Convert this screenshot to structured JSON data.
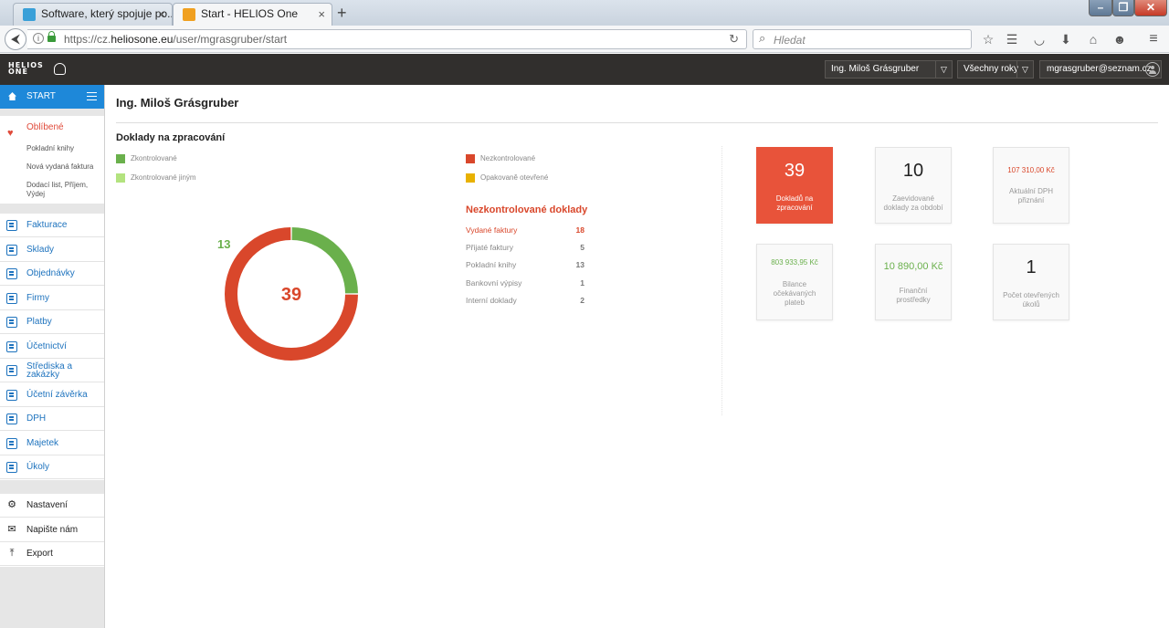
{
  "browser": {
    "tabs": [
      {
        "title": "Software, který spojuje po...",
        "close": "×"
      },
      {
        "title": "Start - HELIOS One",
        "close": "×"
      }
    ],
    "new_tab": "+",
    "url_prefix": "https://cz.",
    "url_domain": "heliosone.eu",
    "url_path": "/user/mgrasgruber/start",
    "search_placeholder": "Hledat"
  },
  "header": {
    "logo_line1": "HELIOS",
    "logo_line2": "ONE",
    "company_select": "Ing. Miloš Grásgruber",
    "year_select": "Všechny roky",
    "user_email": "mgrasgruber@seznam.cz"
  },
  "sidebar": {
    "start_label": "START",
    "favorites_label": "Oblíbené",
    "favorites": [
      "Pokladní knihy",
      "Nová vydaná faktura",
      "Dodací list, Příjem, Výdej"
    ],
    "modules": [
      "Fakturace",
      "Sklady",
      "Objednávky",
      "Firmy",
      "Platby",
      "Účetnictví",
      "Střediska a zakázky",
      "Účetní závěrka",
      "DPH",
      "Majetek",
      "Úkoly"
    ],
    "bottom": [
      {
        "label": "Nastavení",
        "icon": "gear-icon"
      },
      {
        "label": "Napište nám",
        "icon": "envelope-icon"
      },
      {
        "label": "Export",
        "icon": "upload-icon"
      }
    ]
  },
  "main": {
    "title": "Ing. Miloš Grásgruber",
    "section_title": "Doklady na zpracování",
    "legend": [
      {
        "label": "Zkontrolované",
        "color": "#6ab04c"
      },
      {
        "label": "Zkontrolované jiným",
        "color": "#b3e37f"
      },
      {
        "label": "Nezkontrolované",
        "color": "#d9472b"
      },
      {
        "label": "Opakovaně otevřené",
        "color": "#e8b100"
      }
    ],
    "donut": {
      "total": "39",
      "checked_label": "13"
    },
    "unchecked": {
      "title": "Nezkontrolované doklady",
      "rows": [
        {
          "label": "Vydané faktury",
          "value": "18"
        },
        {
          "label": "Přijaté faktury",
          "value": "5"
        },
        {
          "label": "Pokladní knihy",
          "value": "13"
        },
        {
          "label": "Bankovní výpisy",
          "value": "1"
        },
        {
          "label": "Interní doklady",
          "value": "2"
        }
      ]
    },
    "tiles": [
      {
        "value": "39",
        "caption": "Dokladů na zpracování"
      },
      {
        "value": "10",
        "caption": "Zaevidované doklady za období"
      },
      {
        "value": "107 310,00 Kč",
        "caption": "Aktuální DPH přiznání"
      },
      {
        "value": "803 933,95 Kč",
        "caption": "Bilance očekávaných plateb"
      },
      {
        "value": "10 890,00 Kč",
        "caption": "Finanční prostředky"
      },
      {
        "value": "1",
        "caption": "Počet otevřených úkolů"
      }
    ]
  },
  "chart_data": {
    "type": "pie",
    "categories": [
      "Zkontrolované",
      "Zkontrolované jiným",
      "Nezkontrolované",
      "Opakovaně otevřené"
    ],
    "values": [
      13,
      0,
      39,
      0
    ],
    "center_label": "39"
  }
}
